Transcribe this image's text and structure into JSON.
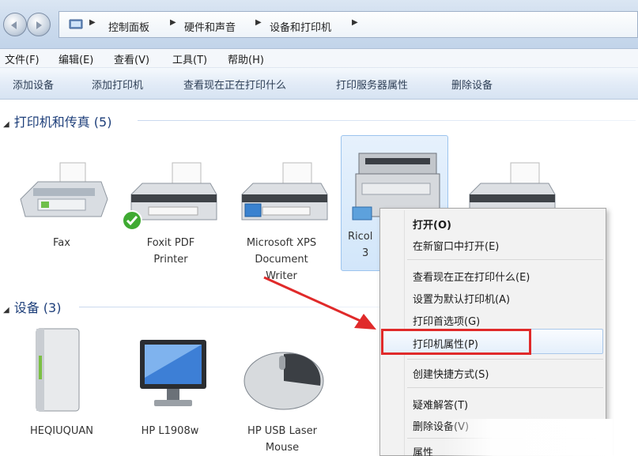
{
  "breadcrumb": {
    "items": [
      "控制面板",
      "硬件和声音",
      "设备和打印机"
    ]
  },
  "menubar": {
    "items": [
      "文件(F)",
      "编辑(E)",
      "查看(V)",
      "工具(T)",
      "帮助(H)"
    ]
  },
  "commandbar": {
    "items": [
      "添加设备",
      "添加打印机",
      "查看现在正在打印什么",
      "打印服务器属性",
      "删除设备"
    ]
  },
  "groups": {
    "printers": {
      "title": "打印机和传真 (5)"
    },
    "devices": {
      "title": "设备 (3)"
    }
  },
  "printers": [
    {
      "name_lines": [
        "Fax"
      ]
    },
    {
      "name_lines": [
        "Foxit PDF",
        "Printer"
      ]
    },
    {
      "name_lines": [
        "Microsoft XPS",
        "Document",
        "Writer"
      ]
    },
    {
      "name_lines": [
        "Ricol",
        "3"
      ]
    }
  ],
  "devices": [
    {
      "name_lines": [
        "HEQIUQUAN"
      ]
    },
    {
      "name_lines": [
        "HP L1908w"
      ]
    },
    {
      "name_lines": [
        "HP USB Laser",
        "Mouse"
      ]
    }
  ],
  "context_menu": {
    "items": [
      "打开(O)",
      "在新窗口中打开(E)",
      "查看现在正在打印什么(E)",
      "设置为默认打印机(A)",
      "打印首选项(G)",
      "打印机属性(P)",
      "创建快捷方式(S)",
      "疑难解答(T)",
      "删除设备(V)",
      "属性"
    ],
    "highlighted": "打印机属性(P)"
  },
  "colors": {
    "annotation": "#e02a2a",
    "group_heading": "#1e3f7a",
    "selection": "#d2e6fa"
  }
}
